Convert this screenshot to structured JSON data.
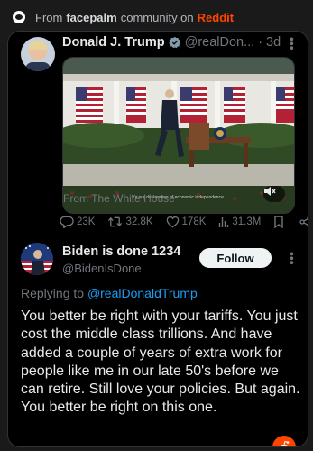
{
  "topbar": {
    "prefix": "From",
    "community": "facepalm",
    "middle": "community on",
    "site": "Reddit"
  },
  "tweet": {
    "name": "Donald J. Trump",
    "handle": "@realDon...",
    "dot": "·",
    "time": "3d",
    "media_caption": "It's our declaration of economic independence",
    "from_text": "From The White House",
    "stats": {
      "replies": "23K",
      "retweets": "32.8K",
      "likes": "178K",
      "views": "31.3M"
    }
  },
  "reply": {
    "name": "Biden is done 1234",
    "handle": "@BidenIsDone",
    "follow_label": "Follow",
    "replying_prefix": "Replying to",
    "replying_mention": "@realDonaldTrump",
    "text": "You better be right with your tariffs. You just cost the middle class trillions. And have added a couple of years of extra work for people like me in our late 50's before we can retire. Still love your policies. But again. You better be right on this one."
  },
  "icons": {
    "reddit_logo": "reddit-logo-icon",
    "verified": "verified-badge-icon",
    "more": "more-options-icon",
    "mute": "mute-icon",
    "reply": "reply-icon",
    "retweet": "retweet-icon",
    "like": "heart-icon",
    "views": "views-icon",
    "bookmark": "bookmark-icon",
    "share": "share-icon",
    "snoo": "reddit-snoo-icon"
  },
  "colors": {
    "reddit_orange": "#ff4500",
    "link_blue": "#1d9bf0",
    "verified_gray": "#829aab"
  }
}
